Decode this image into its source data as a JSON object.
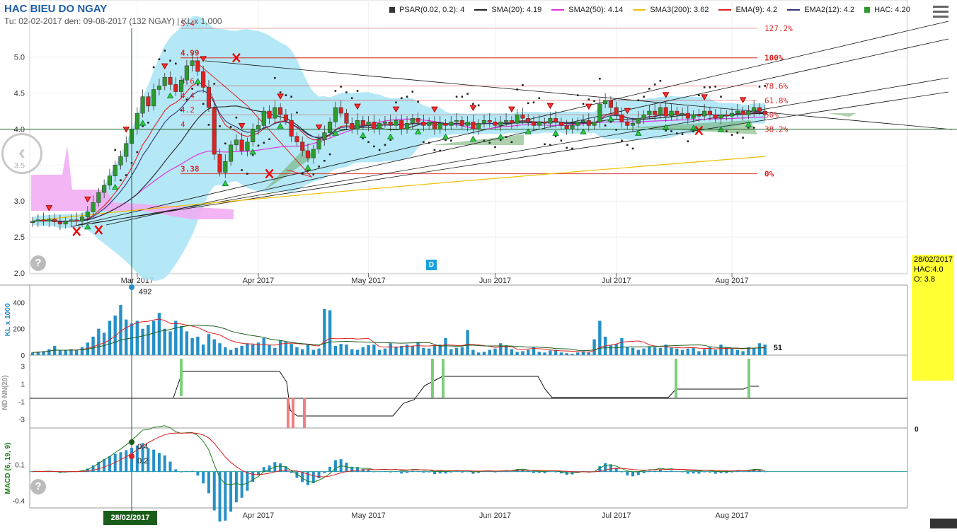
{
  "header": {
    "title": "HAC BIEU DO NGAY",
    "subtitle": "Tu: 02-02-2017 den: 09-08-2017 (132 NGAY) | KL x 1,000"
  },
  "legend": [
    {
      "label": "PSAR(0.02, 0.2): 4",
      "kind": "square",
      "color": "#333333"
    },
    {
      "label": "SMA(20): 4.19",
      "kind": "line",
      "color": "#222222"
    },
    {
      "label": "SMA2(50): 4.14",
      "kind": "line",
      "color": "#dd33dd"
    },
    {
      "label": "SMA3(200): 3.62",
      "kind": "line",
      "color": "#f0c000"
    },
    {
      "label": "EMA(9): 4.2",
      "kind": "line",
      "color": "#dd2222"
    },
    {
      "label": "EMA2(12): 4.2",
      "kind": "line",
      "color": "#33337a"
    },
    {
      "label": "HAC: 4.20",
      "kind": "square",
      "color": "#2e9a2e"
    }
  ],
  "infobox": {
    "date": "28/02/2017",
    "hac": "HAC:4.0",
    "o_label": "O:",
    "o_value": "3.8"
  },
  "crosshair": {
    "date": "28/02/2017",
    "price": 4.0
  },
  "badge_d": "D",
  "colors": {
    "up": "#2e9a2e",
    "down": "#dd2222",
    "volume": "#2590c8",
    "cloud": "#a8e4f5",
    "fib": "#dd2222"
  },
  "chart_data": [
    {
      "type": "candlestick",
      "name": "price",
      "x": [
        "2017-02-02",
        "2017-02-03",
        "2017-02-06",
        "2017-02-07",
        "2017-02-08",
        "2017-02-09",
        "2017-02-10",
        "2017-02-13",
        "2017-02-14",
        "2017-02-15",
        "2017-02-16",
        "2017-02-17",
        "2017-02-20",
        "2017-02-21",
        "2017-02-22",
        "2017-02-23",
        "2017-02-24",
        "2017-02-27",
        "2017-02-28",
        "2017-03-01",
        "2017-03-02",
        "2017-03-03",
        "2017-03-06",
        "2017-03-07",
        "2017-03-08",
        "2017-03-09",
        "2017-03-10",
        "2017-03-13",
        "2017-03-14",
        "2017-03-15",
        "2017-03-16",
        "2017-03-17",
        "2017-03-20",
        "2017-03-21",
        "2017-03-22",
        "2017-03-23",
        "2017-03-24",
        "2017-03-27",
        "2017-03-28",
        "2017-03-29",
        "2017-03-30",
        "2017-03-31",
        "2017-04-03",
        "2017-04-04",
        "2017-04-05",
        "2017-04-06",
        "2017-04-07",
        "2017-04-10",
        "2017-04-11",
        "2017-04-12",
        "2017-04-13",
        "2017-04-14",
        "2017-04-17",
        "2017-04-18",
        "2017-04-19",
        "2017-04-20",
        "2017-04-21",
        "2017-04-24",
        "2017-04-25",
        "2017-04-26",
        "2017-04-27",
        "2017-04-28",
        "2017-05-02",
        "2017-05-03",
        "2017-05-04",
        "2017-05-05",
        "2017-05-08",
        "2017-05-09",
        "2017-05-10",
        "2017-05-11",
        "2017-05-12",
        "2017-05-15",
        "2017-05-16",
        "2017-05-17",
        "2017-05-18",
        "2017-05-19",
        "2017-05-22",
        "2017-05-23",
        "2017-05-24",
        "2017-05-25",
        "2017-05-26",
        "2017-05-29",
        "2017-05-30",
        "2017-05-31",
        "2017-06-01",
        "2017-06-02",
        "2017-06-05",
        "2017-06-06",
        "2017-06-07",
        "2017-06-08",
        "2017-06-09",
        "2017-06-12",
        "2017-06-13",
        "2017-06-14",
        "2017-06-15",
        "2017-06-16",
        "2017-06-19",
        "2017-06-20",
        "2017-06-21",
        "2017-06-22",
        "2017-06-23",
        "2017-06-26",
        "2017-06-27",
        "2017-06-28",
        "2017-06-29",
        "2017-06-30",
        "2017-07-03",
        "2017-07-04",
        "2017-07-05",
        "2017-07-06",
        "2017-07-07",
        "2017-07-10",
        "2017-07-11",
        "2017-07-12",
        "2017-07-13",
        "2017-07-14",
        "2017-07-17",
        "2017-07-18",
        "2017-07-19",
        "2017-07-20",
        "2017-07-21",
        "2017-07-24",
        "2017-07-25",
        "2017-07-26",
        "2017-07-27",
        "2017-07-28",
        "2017-07-31",
        "2017-08-01",
        "2017-08-02",
        "2017-08-03",
        "2017-08-04",
        "2017-08-07",
        "2017-08-08",
        "2017-08-09"
      ],
      "close": [
        2.72,
        2.74,
        2.72,
        2.75,
        2.71,
        2.68,
        2.72,
        2.74,
        2.72,
        2.78,
        2.85,
        2.98,
        3.12,
        3.22,
        3.35,
        3.5,
        3.62,
        3.8,
        4.0,
        4.22,
        4.45,
        4.32,
        4.55,
        4.6,
        4.72,
        4.62,
        4.52,
        4.68,
        4.88,
        4.95,
        4.8,
        4.58,
        4.3,
        3.65,
        3.4,
        3.55,
        3.78,
        3.85,
        3.7,
        3.82,
        4.0,
        4.05,
        4.25,
        4.15,
        4.3,
        4.2,
        4.12,
        3.9,
        3.82,
        3.7,
        3.6,
        3.72,
        3.85,
        3.95,
        4.1,
        4.3,
        4.22,
        4.08,
        4.0,
        4.12,
        4.05,
        4.1,
        4.0,
        4.08,
        4.1,
        4.05,
        4.12,
        4.0,
        4.08,
        4.15,
        4.1,
        4.05,
        4.1,
        4.0,
        4.08,
        4.05,
        4.1,
        4.12,
        4.05,
        4.1,
        4.0,
        4.08,
        4.12,
        4.1,
        4.05,
        4.1,
        4.12,
        4.08,
        4.2,
        4.15,
        4.1,
        4.05,
        4.1,
        4.08,
        4.15,
        4.1,
        4.05,
        4.0,
        4.05,
        4.1,
        4.12,
        4.05,
        4.1,
        4.35,
        4.4,
        4.3,
        4.2,
        4.1,
        4.05,
        4.08,
        4.15,
        4.2,
        4.25,
        4.2,
        4.3,
        4.18,
        4.25,
        4.2,
        4.22,
        4.15,
        4.2,
        4.18,
        4.25,
        4.2,
        4.15,
        4.2,
        4.18,
        4.22,
        4.25,
        4.2,
        4.25,
        4.3,
        4.25,
        4.2
      ],
      "volume": [
        20,
        25,
        30,
        45,
        70,
        35,
        38,
        45,
        40,
        60,
        95,
        140,
        200,
        170,
        260,
        300,
        380,
        270,
        240,
        260,
        200,
        230,
        260,
        320,
        200,
        180,
        260,
        220,
        180,
        130,
        140,
        80,
        160,
        120,
        90,
        60,
        40,
        55,
        70,
        90,
        80,
        95,
        130,
        75,
        55,
        110,
        100,
        85,
        60,
        45,
        80,
        40,
        50,
        350,
        340,
        70,
        85,
        80,
        45,
        40,
        60,
        75,
        80,
        40,
        50,
        90,
        65,
        70,
        80,
        70,
        100,
        55,
        50,
        75,
        80,
        130,
        45,
        55,
        60,
        190,
        40,
        20,
        25,
        40,
        50,
        90,
        75,
        45,
        25,
        30,
        40,
        60,
        25,
        20,
        35,
        40,
        20,
        15,
        10,
        20,
        30,
        20,
        120,
        260,
        140,
        75,
        85,
        130,
        60,
        55,
        40,
        50,
        65,
        60,
        55,
        80,
        55,
        50,
        40,
        50,
        55,
        30,
        45,
        60,
        40,
        80,
        60,
        50,
        40,
        30,
        60,
        55,
        90,
        80
      ],
      "ylim": [
        2.0,
        5.4
      ],
      "yticks": [
        2.0,
        2.5,
        3.0,
        3.5,
        4.0,
        4.5,
        5.0
      ],
      "xticks": [
        {
          "label": "Mar 2017",
          "i": 19
        },
        {
          "label": "Apr 2017",
          "i": 41
        },
        {
          "label": "May 2017",
          "i": 61
        },
        {
          "label": "Jun 2017",
          "i": 84
        },
        {
          "label": "Jul 2017",
          "i": 106
        },
        {
          "label": "Aug 2017",
          "i": 127
        }
      ],
      "fib_levels": [
        {
          "price": 5.4,
          "left_label": "5.4",
          "right_label": "127.2%"
        },
        {
          "price": 4.99,
          "left_label": "4.99",
          "right_label": "100%"
        },
        {
          "price": 4.6,
          "left_label": "4.6",
          "right_label": "78.6%"
        },
        {
          "price": 4.4,
          "left_label": "4.4",
          "right_label": "61.8%"
        },
        {
          "price": 4.2,
          "left_label": "4.2",
          "right_label": "50%"
        },
        {
          "price": 4.0,
          "left_label": "4",
          "right_label": "38.2%"
        },
        {
          "price": 3.38,
          "left_label": "3.38",
          "right_label": "0%"
        }
      ],
      "sma3_200": [
        3.62
      ],
      "x_marks": [
        {
          "i": 8,
          "price": 2.58
        },
        {
          "i": 12,
          "price": 2.6
        },
        {
          "i": 37,
          "price": 4.99
        },
        {
          "i": 43,
          "price": 3.38
        },
        {
          "i": 121,
          "price": 3.98
        }
      ]
    },
    {
      "type": "bar",
      "name": "volume",
      "ylabel": "KL x 1000",
      "yticks": [
        0,
        200,
        400
      ],
      "ylim": [
        0,
        520
      ],
      "max_label": "492",
      "last_label": "51"
    },
    {
      "type": "line",
      "name": "ND NN(20)",
      "ylabel": "ND NN(20)",
      "yticks": [
        -3,
        -1,
        1,
        3
      ],
      "ylim": [
        -4,
        4
      ]
    },
    {
      "type": "line",
      "name": "MACD",
      "ylabel": "MACD (6, 19, 9)",
      "yticks": [
        -0.4,
        0.1
      ],
      "ylim": [
        -0.5,
        0.6
      ],
      "label_a": "0.4",
      "label_b": "0.2",
      "right_label": "0"
    }
  ]
}
